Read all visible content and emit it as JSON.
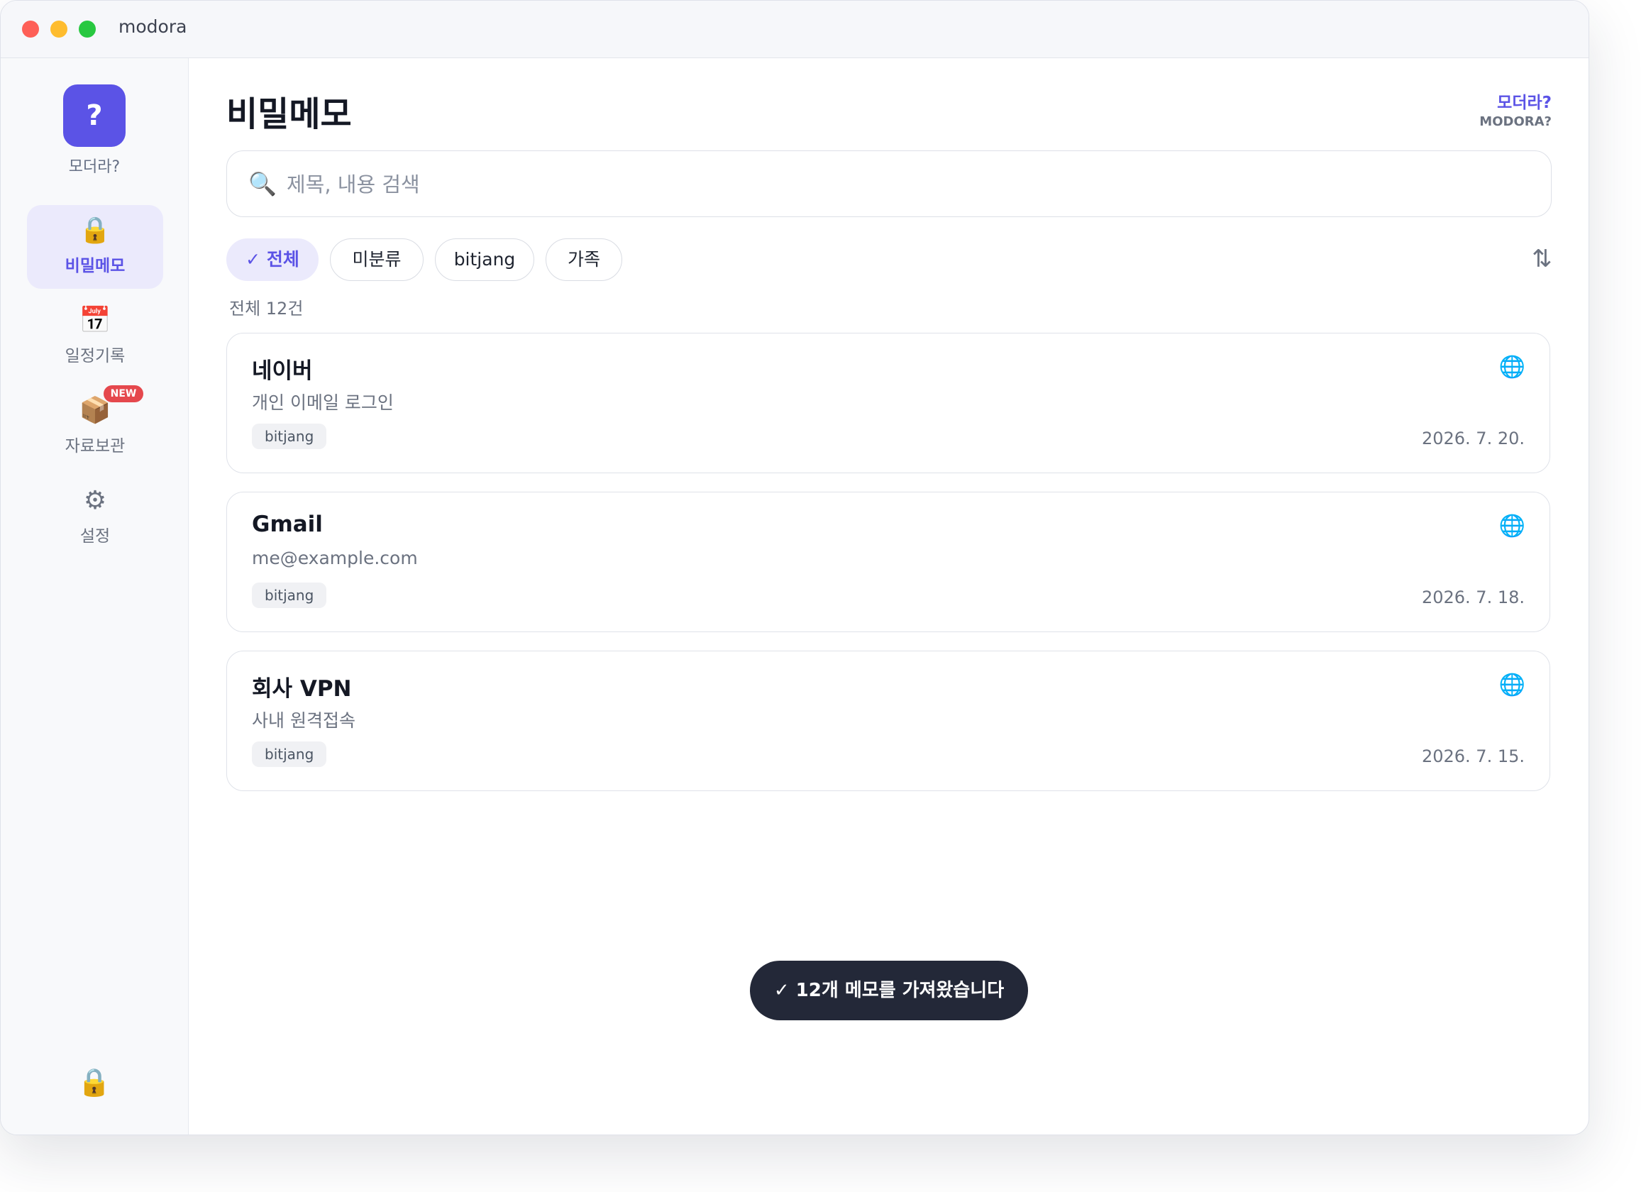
{
  "window": {
    "title": "modora"
  },
  "sidebar": {
    "brand": {
      "logo": "?",
      "label": "모더라?"
    },
    "items": [
      {
        "label": "비밀메모",
        "icon": "lock-icon",
        "glyph": "🔒",
        "active": true
      },
      {
        "label": "일정기록",
        "icon": "calendar-icon",
        "glyph": "📅",
        "active": false
      },
      {
        "label": "자료보관",
        "icon": "package-icon",
        "glyph": "📦",
        "badge": "NEW",
        "active": false
      },
      {
        "label": "설정",
        "icon": "gear-icon",
        "glyph": "⚙",
        "active": false
      }
    ],
    "lock_glyph": "🔒"
  },
  "header": {
    "title": "비밀메모",
    "help_label": "모더라?",
    "help_sub": "MODORA?"
  },
  "search": {
    "placeholder": "제목, 내용 검색",
    "icon_glyph": "🔍"
  },
  "filters": [
    {
      "label": "✓ 전체",
      "active": true
    },
    {
      "label": "미분류",
      "active": false
    },
    {
      "label": "bitjang",
      "active": false
    },
    {
      "label": "가족",
      "active": false
    }
  ],
  "sort_glyph": "⇅",
  "count_label": "전체 12건",
  "memos": [
    {
      "title": "네이버",
      "subtitle": "개인 이메일 로그인",
      "tag": "bitjang",
      "date": "2026. 7. 20.",
      "icon": "globe-icon",
      "glyph": "🌐"
    },
    {
      "title": "Gmail",
      "subtitle": "me@example.com",
      "tag": "bitjang",
      "date": "2026. 7. 18.",
      "icon": "globe-icon",
      "glyph": "🌐"
    },
    {
      "title": "회사 VPN",
      "subtitle": "사내 원격접속",
      "tag": "bitjang",
      "date": "2026. 7. 15.",
      "icon": "globe-icon",
      "glyph": "🌐"
    }
  ],
  "toast": "✓ 12개 메모를 가져왔습니다",
  "colors": {
    "accent": "#5b53e6",
    "badge": "#e5484d",
    "toast_bg": "#232838"
  }
}
